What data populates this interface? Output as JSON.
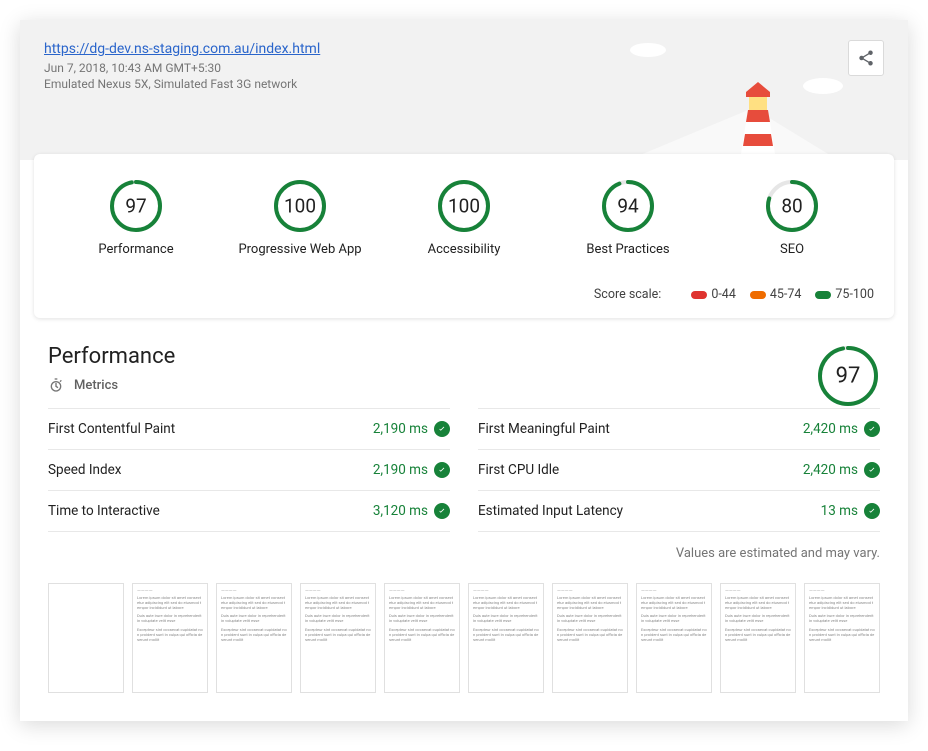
{
  "header": {
    "url": "https://dg-dev.ns-staging.com.au/index.html",
    "timestamp": "Jun 7, 2018, 10:43 AM GMT+5:30",
    "device": "Emulated Nexus 5X, Simulated Fast 3G network"
  },
  "gauges": [
    {
      "label": "Performance",
      "score": 97,
      "color": "#178239"
    },
    {
      "label": "Progressive Web App",
      "score": 100,
      "color": "#178239"
    },
    {
      "label": "Accessibility",
      "score": 100,
      "color": "#178239"
    },
    {
      "label": "Best Practices",
      "score": 94,
      "color": "#178239"
    },
    {
      "label": "SEO",
      "score": 80,
      "color": "#178239"
    }
  ],
  "score_scale": {
    "label": "Score scale:",
    "ranges": [
      {
        "text": "0-44",
        "color": "#df332f"
      },
      {
        "text": "45-74",
        "color": "#ef6c00"
      },
      {
        "text": "75-100",
        "color": "#178239"
      }
    ]
  },
  "performance": {
    "title": "Performance",
    "score": 97,
    "metrics_label": "Metrics",
    "metrics": [
      {
        "name": "First Contentful Paint",
        "value": "2,190 ms"
      },
      {
        "name": "First Meaningful Paint",
        "value": "2,420 ms"
      },
      {
        "name": "Speed Index",
        "value": "2,190 ms"
      },
      {
        "name": "First CPU Idle",
        "value": "2,420 ms"
      },
      {
        "name": "Time to Interactive",
        "value": "3,120 ms"
      },
      {
        "name": "Estimated Input Latency",
        "value": "13 ms"
      }
    ],
    "disclaimer": "Values are estimated and may vary."
  },
  "filmstrip": {
    "frames": 10,
    "blank_until": 1
  }
}
